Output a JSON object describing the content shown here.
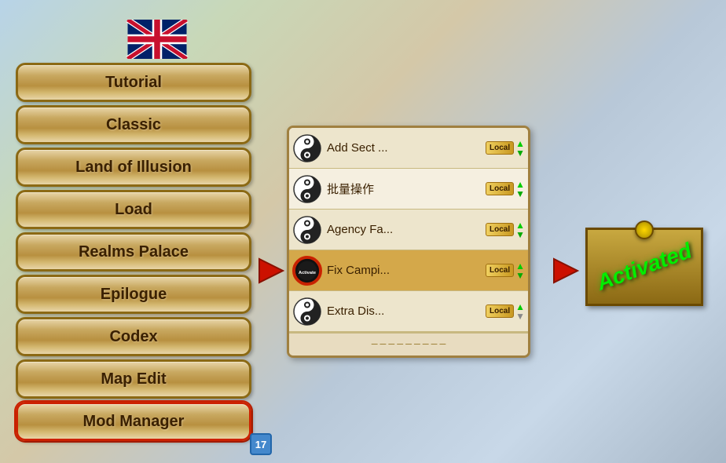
{
  "background": {
    "color": "#a8c4d4"
  },
  "flag": {
    "alt": "UK Flag"
  },
  "menu": {
    "items": [
      {
        "id": "tutorial",
        "label": "Tutorial"
      },
      {
        "id": "classic",
        "label": "Classic"
      },
      {
        "id": "land-of-illusion",
        "label": "Land of Illusion"
      },
      {
        "id": "load",
        "label": "Load"
      },
      {
        "id": "realms-palace",
        "label": "Realms Palace"
      },
      {
        "id": "epilogue",
        "label": "Epilogue"
      },
      {
        "id": "codex",
        "label": "Codex"
      },
      {
        "id": "map-edit",
        "label": "Map Edit"
      },
      {
        "id": "mod-manager",
        "label": "Mod Manager",
        "selected": true
      }
    ]
  },
  "mod_panel": {
    "items": [
      {
        "id": "add-sect",
        "name": "Add Sect ...",
        "badge": "Local",
        "has_icon": "yinyang",
        "active": false
      },
      {
        "id": "bulk-ops",
        "name": "批量操作",
        "badge": "Local",
        "has_icon": "yinyang",
        "active": false
      },
      {
        "id": "agency-fa",
        "name": "Agency Fa...",
        "badge": "Local",
        "has_icon": "yinyang",
        "active": false
      },
      {
        "id": "fix-campi",
        "name": "Fix Campi...",
        "badge": "Local",
        "has_icon": "activate",
        "active": true,
        "icon_text": "Activate"
      },
      {
        "id": "extra-dis",
        "name": "Extra Dis...",
        "badge": "Local",
        "has_icon": "yinyang",
        "active": false
      }
    ],
    "footer_text": ""
  },
  "arrows": {
    "left_arrow": "▶",
    "right_arrow": "▶"
  },
  "activated": {
    "label": "Activated"
  },
  "number_badge": {
    "value": "17"
  }
}
